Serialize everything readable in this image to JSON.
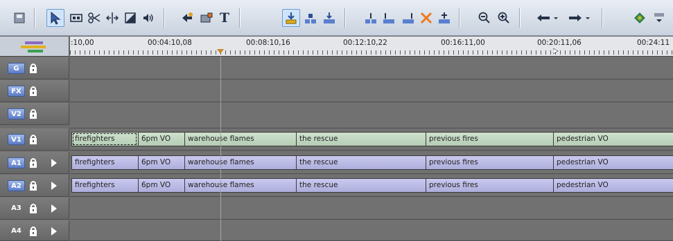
{
  "toolbar": {
    "title_tool": "T"
  },
  "ruler": {
    "timecodes": [
      ":10,00",
      "00:04:10,08",
      "00:08:10,16",
      "00:12:10,22",
      "00:16:11,00",
      "00:20:11,06",
      "00:24:11"
    ]
  },
  "tracks": [
    {
      "id": "G",
      "badge": "G",
      "badge_style": "blue",
      "has_play": false
    },
    {
      "id": "FX",
      "badge": "FX",
      "badge_style": "blue",
      "has_play": false
    },
    {
      "id": "V2",
      "badge": "V2",
      "badge_style": "blue",
      "has_play": false
    },
    {
      "id": "V1",
      "badge": "V1",
      "badge_style": "blue",
      "has_play": false
    },
    {
      "id": "A1",
      "badge": "A1",
      "badge_style": "blue",
      "has_play": true
    },
    {
      "id": "A2",
      "badge": "A2",
      "badge_style": "blue",
      "has_play": true
    },
    {
      "id": "A3",
      "badge": "A3",
      "badge_style": "plain",
      "has_play": true
    },
    {
      "id": "A4",
      "badge": "A4",
      "badge_style": "plain",
      "has_play": true
    }
  ],
  "clips": {
    "v1": [
      "firefighters",
      "6pm VO",
      "warehouse flames",
      "the rescue",
      "previous fires",
      "pedestrian VO"
    ],
    "a1": [
      "firefighters",
      "6pm VO",
      "warehouse flames",
      "the rescue",
      "previous fires",
      "pedestrian VO"
    ],
    "a2": [
      "firefighters",
      "6pm VO",
      "warehouse flames",
      "the rescue",
      "previous fires",
      "pedestrian VO"
    ]
  },
  "colors": {
    "video_clip": "#c4d9c4",
    "audio_clip": "#bcbce6",
    "track_bg": "#717171",
    "selected_tool": "#cfe4fb"
  }
}
